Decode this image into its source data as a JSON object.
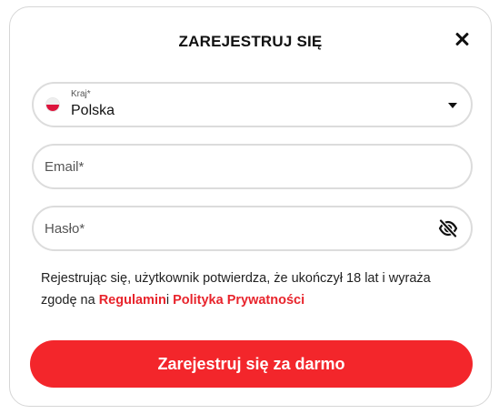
{
  "modal": {
    "title": "ZAREJESTRUJ SIĘ",
    "close_icon": "close-icon"
  },
  "form": {
    "country": {
      "label": "Kraj*",
      "value": "Polska",
      "flag_icon": "poland-flag-icon",
      "dropdown_icon": "caret-down-icon"
    },
    "email": {
      "placeholder": "Email*"
    },
    "password": {
      "placeholder": "Hasło*",
      "visibility_icon": "eye-slash-icon"
    }
  },
  "terms": {
    "text": "Rejestrując się, użytkownik potwierdza, że ukończył 18 lat i wyraża zgodę na ",
    "link_regulamin": "Regulamin",
    "conjunction": "i ",
    "link_privacy": "Polityka Prywatności"
  },
  "submit": {
    "label": "Zarejestruj się za darmo"
  },
  "colors": {
    "accent": "#f3262b",
    "link": "#e8242c",
    "border": "#dcdcdc",
    "text": "#111111"
  }
}
